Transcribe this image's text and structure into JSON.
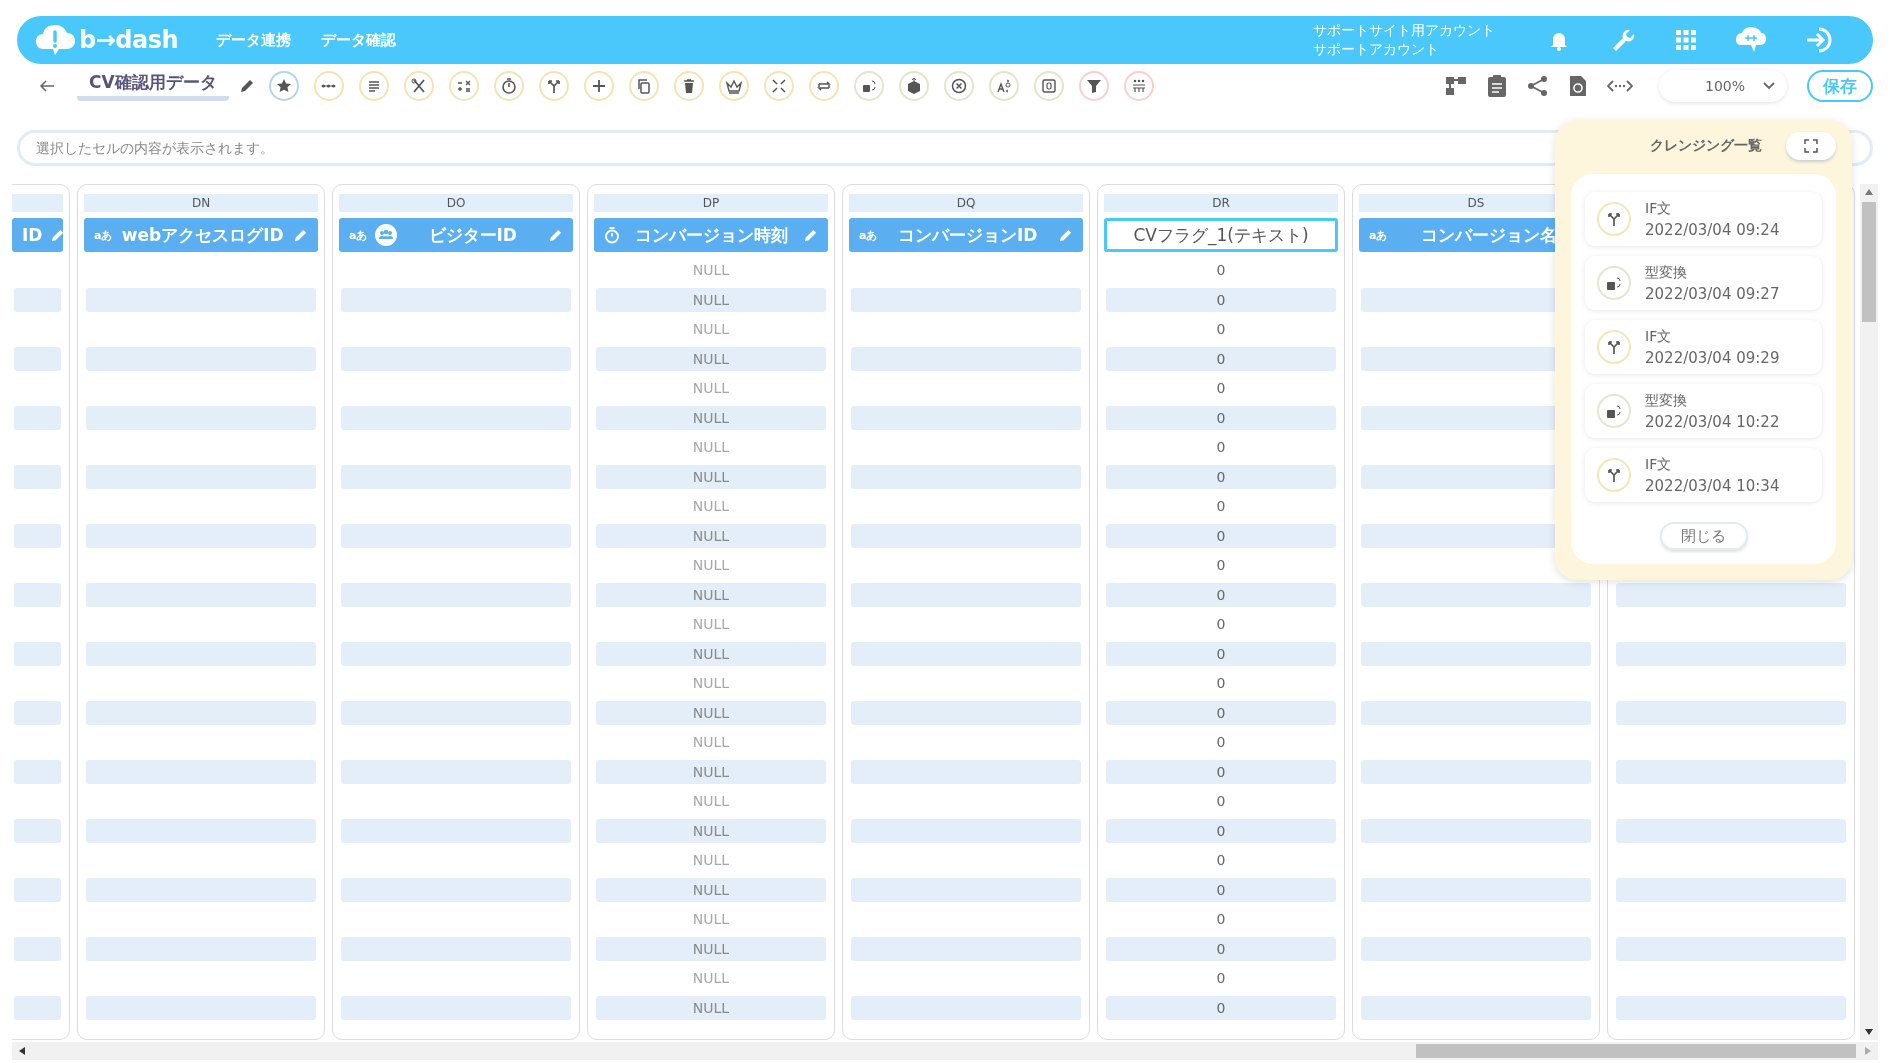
{
  "header": {
    "logo": "b→dash",
    "nav": [
      {
        "label": "データ連携"
      },
      {
        "label": "データ確認"
      }
    ],
    "account": [
      "サポートサイト用アカウント",
      "サポートアカウント"
    ]
  },
  "toolbar": {
    "title": "CV確認用データ",
    "tools": [
      {
        "color": "#b8d2ea"
      },
      {
        "color": "#f3e3b5"
      },
      {
        "color": "#f3e3b5"
      },
      {
        "color": "#f3e3b5"
      },
      {
        "color": "#f3e3b5"
      },
      {
        "color": "#f3e3b5"
      },
      {
        "color": "#f3e3b5"
      },
      {
        "color": "#f3e3b5"
      },
      {
        "color": "#f3e3b5"
      },
      {
        "color": "#f3e3b5"
      },
      {
        "color": "#f3e3b5"
      },
      {
        "color": "#f3e3b5"
      },
      {
        "color": "#f3e3b5"
      },
      {
        "color": "#dfe6cc"
      },
      {
        "color": "#dfe6cc"
      },
      {
        "color": "#dfe6cc"
      },
      {
        "color": "#dfe6cc"
      },
      {
        "color": "#dfe6cc"
      },
      {
        "color": "#f6cfcf"
      },
      {
        "color": "#f6cfcf"
      }
    ],
    "zoom": "100%",
    "save": "保存"
  },
  "cell_preview": {
    "placeholder": "選択したセルの内容が表示されます。"
  },
  "columns": [
    {
      "name": "ID",
      "kind": "text",
      "editable": true,
      "selected": false,
      "visitor_badge": false
    },
    {
      "letter": "DN",
      "type_label": "aあ",
      "name": "webアクセスログID",
      "kind": "text",
      "editable": true,
      "selected": false,
      "visitor_badge": false
    },
    {
      "letter": "DO",
      "type_label": "aあ",
      "name": "ビジターID",
      "kind": "text",
      "editable": true,
      "selected": false,
      "visitor_badge": true
    },
    {
      "letter": "DP",
      "name": "コンバージョン時刻",
      "kind": "datetime",
      "editable": true,
      "selected": false,
      "visitor_badge": false,
      "values": [
        "NULL",
        "NULL",
        "NULL",
        "NULL",
        "NULL",
        "NULL",
        "NULL",
        "NULL",
        "NULL",
        "NULL",
        "NULL",
        "NULL",
        "NULL",
        "NULL",
        "NULL",
        "NULL",
        "NULL",
        "NULL",
        "NULL",
        "NULL",
        "NULL",
        "NULL",
        "NULL",
        "NULL",
        "NULL",
        "NULL"
      ]
    },
    {
      "letter": "DQ",
      "type_label": "aあ",
      "name": "コンバージョンID",
      "kind": "text",
      "editable": true,
      "selected": false,
      "visitor_badge": false
    },
    {
      "letter": "DR",
      "name": "CVフラグ_1(テキスト)",
      "kind": "text",
      "editable": false,
      "selected": true,
      "visitor_badge": false,
      "values": [
        "0",
        "0",
        "0",
        "0",
        "0",
        "0",
        "0",
        "0",
        "0",
        "0",
        "0",
        "0",
        "0",
        "0",
        "0",
        "0",
        "0",
        "0",
        "0",
        "0",
        "0",
        "0",
        "0",
        "0",
        "0",
        "0"
      ]
    },
    {
      "letter": "DS",
      "type_label": "aあ",
      "name": "コンバージョン名",
      "kind": "text",
      "editable": false,
      "selected": false,
      "visitor_badge": false
    },
    {}
  ],
  "cleansing_panel": {
    "title": "クレンジング一覧",
    "items": [
      {
        "kind": "if",
        "name": "IF文",
        "time": "2022/03/04 09:24"
      },
      {
        "kind": "convert",
        "name": "型変換",
        "time": "2022/03/04 09:27"
      },
      {
        "kind": "if",
        "name": "IF文",
        "time": "2022/03/04 09:29"
      },
      {
        "kind": "convert",
        "name": "型変換",
        "time": "2022/03/04 10:22"
      },
      {
        "kind": "if",
        "name": "IF文",
        "time": "2022/03/04 10:34"
      }
    ],
    "close": "閉じる"
  }
}
